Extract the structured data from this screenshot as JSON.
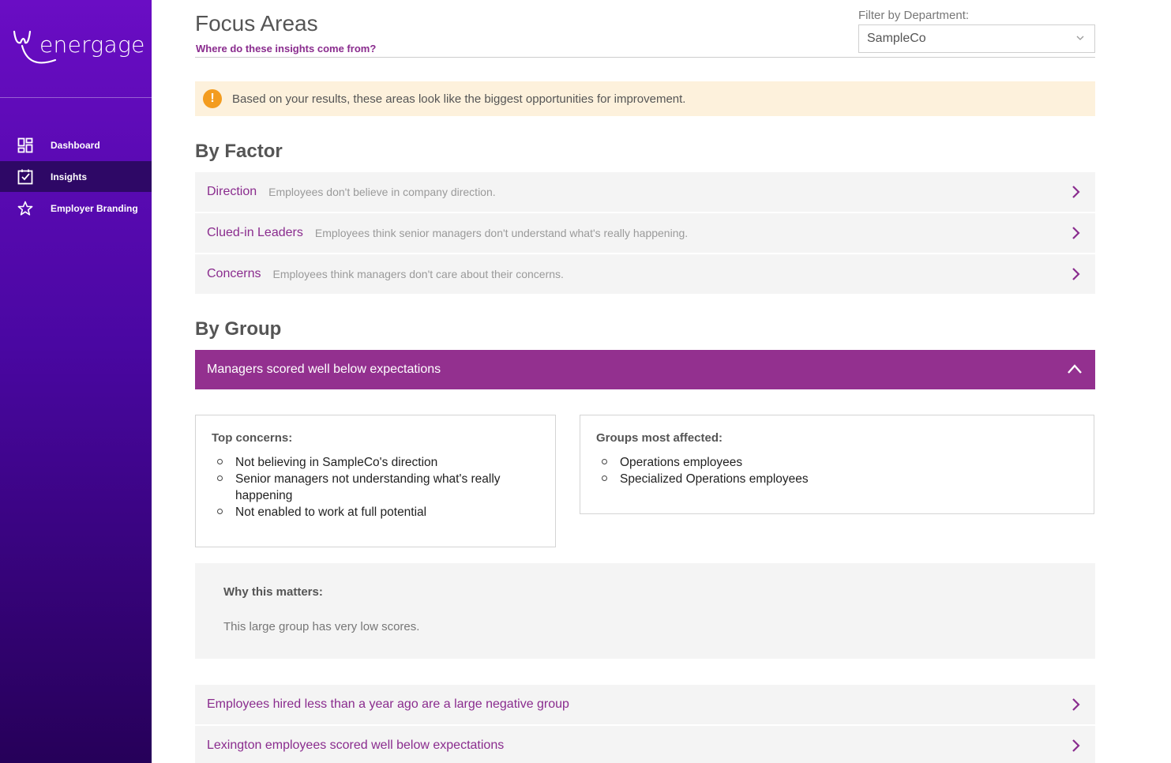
{
  "brand": {
    "name": "energage"
  },
  "sidebar": {
    "items": [
      {
        "label": "Dashboard",
        "icon": "dashboard-grid-icon"
      },
      {
        "label": "Insights",
        "icon": "checkbox-icon"
      },
      {
        "label": "Employer Branding",
        "icon": "star-icon"
      }
    ]
  },
  "header": {
    "title": "Focus Areas",
    "insights_link": "Where do these insights come from?",
    "filter_label": "Filter by Department:",
    "filter_value": "SampleCo"
  },
  "alert": {
    "text": "Based on your results, these areas look like the biggest opportunities for improvement."
  },
  "by_factor": {
    "title": "By Factor",
    "items": [
      {
        "name": "Direction",
        "desc": "Employees don't believe in company direction."
      },
      {
        "name": "Clued-in Leaders",
        "desc": "Employees think senior managers don't understand what's really happening."
      },
      {
        "name": "Concerns",
        "desc": "Employees think managers don't care about their concerns."
      }
    ]
  },
  "by_group": {
    "title": "By Group",
    "expanded": {
      "title": "Managers scored well below expectations",
      "top_concerns_title": "Top concerns:",
      "top_concerns": [
        "Not believing in SampleCo's direction",
        "Senior managers not understanding what's really happening",
        "Not enabled to work at full potential"
      ],
      "groups_title": "Groups most affected:",
      "groups": [
        "Operations employees",
        "Specialized Operations employees"
      ],
      "why_title": "Why this matters:",
      "why_text": "This large group has very low scores."
    },
    "collapsed": [
      {
        "title": "Employees hired less than a year ago are a large negative group"
      },
      {
        "title": "Lexington employees scored well below expectations"
      }
    ]
  },
  "colors": {
    "accent": "#93308f",
    "link": "#8a2c8e",
    "alert_bg": "#fdf1dc",
    "alert_icon": "#f39c1f"
  }
}
